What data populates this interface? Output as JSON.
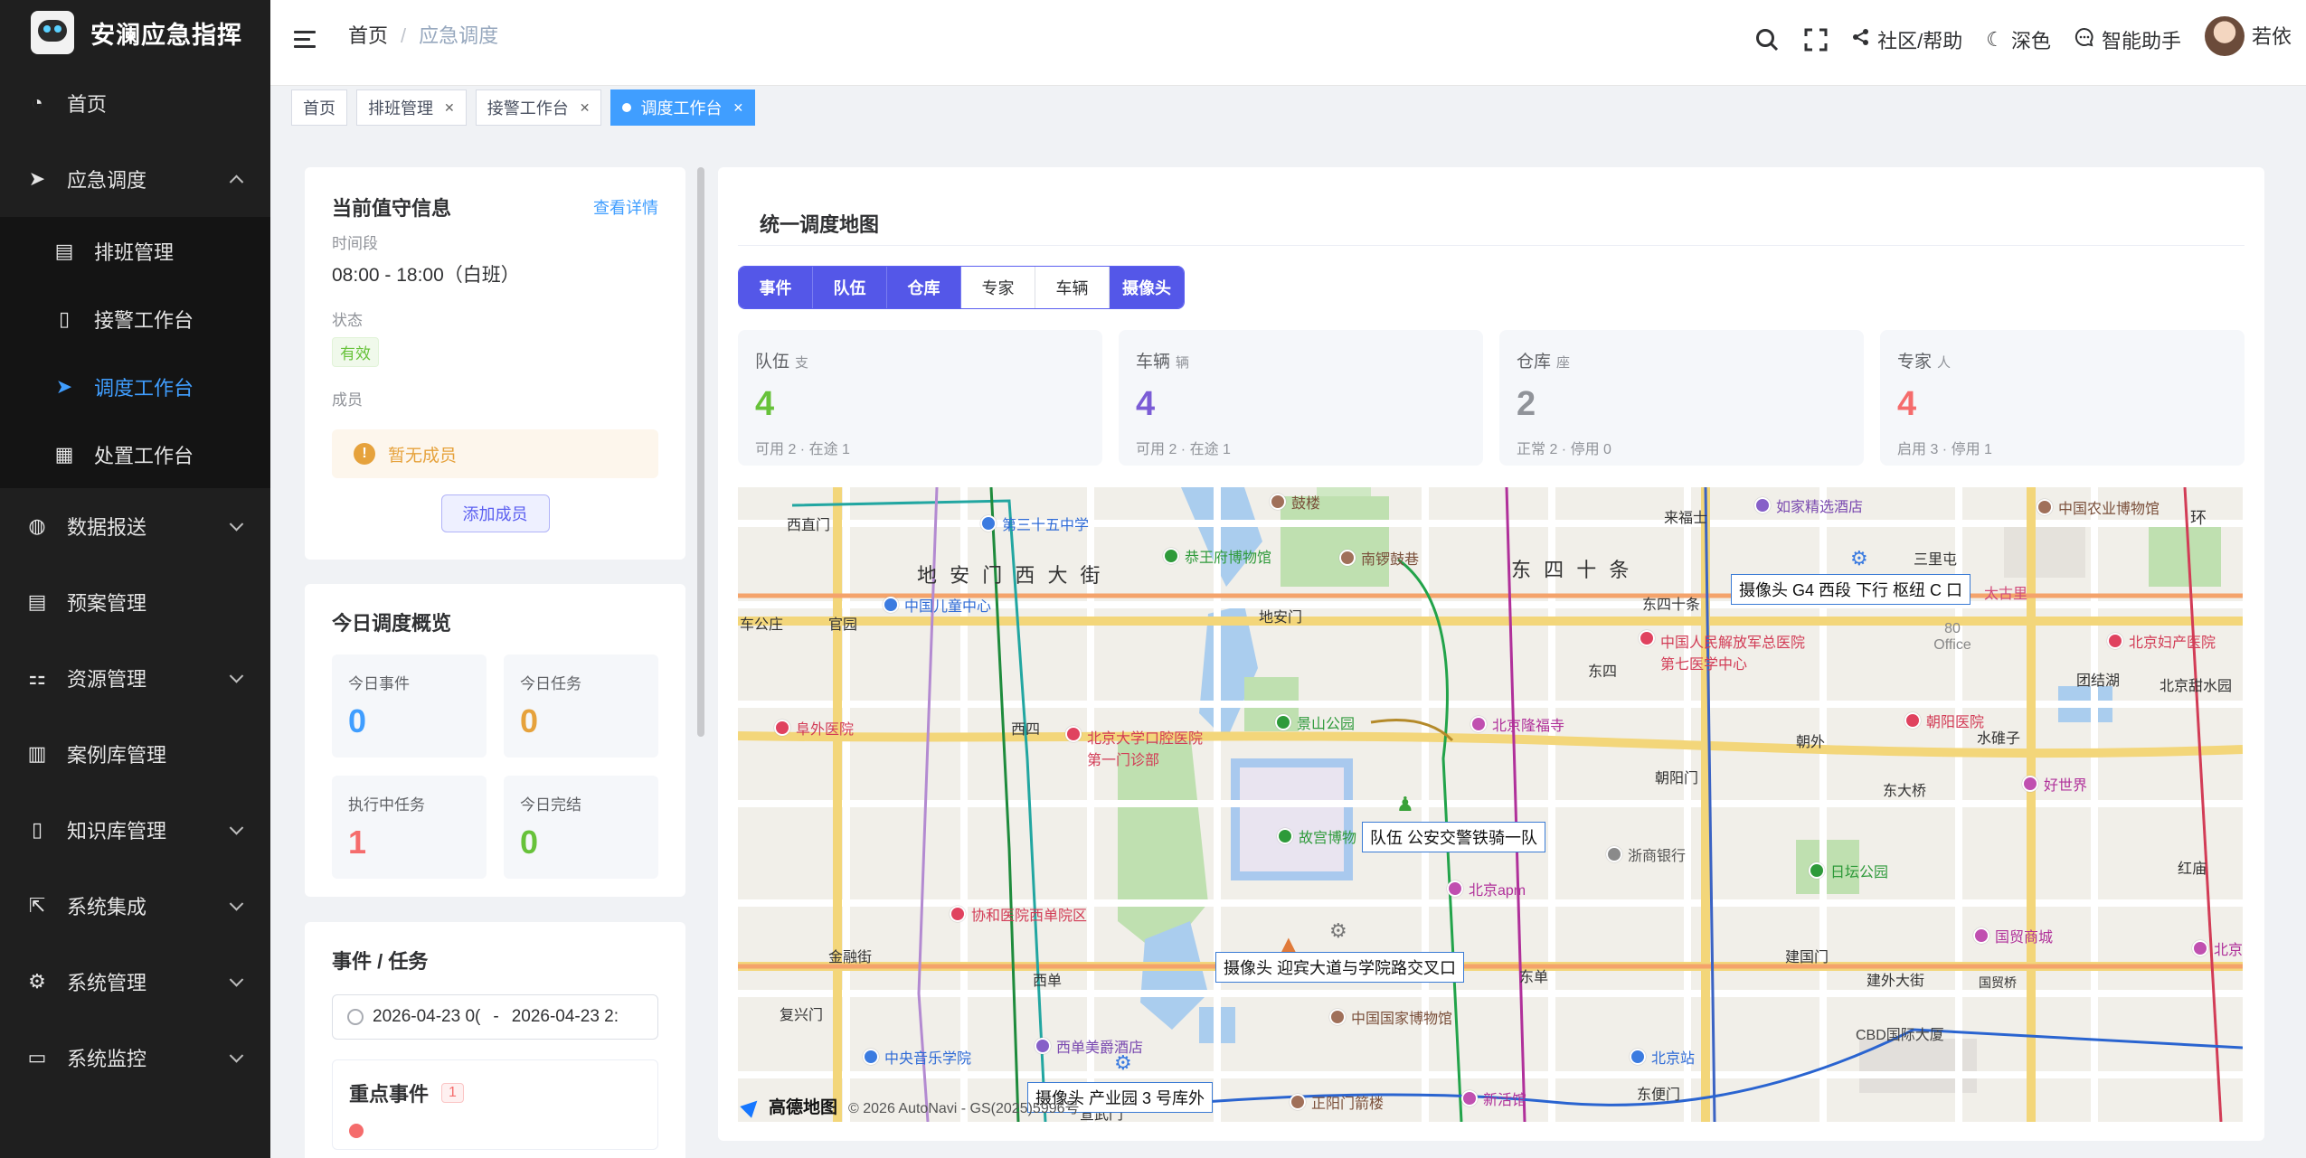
{
  "app": {
    "name": "安澜应急指挥"
  },
  "sidebar": {
    "items": [
      {
        "label": "首页"
      },
      {
        "label": "应急调度",
        "expanded": true
      },
      {
        "label": "数据报送"
      },
      {
        "label": "预案管理"
      },
      {
        "label": "资源管理"
      },
      {
        "label": "案例库管理"
      },
      {
        "label": "知识库管理"
      },
      {
        "label": "系统集成"
      },
      {
        "label": "系统管理"
      },
      {
        "label": "系统监控"
      }
    ],
    "subitems": [
      {
        "label": "排班管理"
      },
      {
        "label": "接警工作台"
      },
      {
        "label": "调度工作台",
        "active": true
      },
      {
        "label": "处置工作台"
      }
    ],
    "active_color": "#409eff"
  },
  "header": {
    "breadcrumb": [
      "首页",
      "应急调度"
    ],
    "actions": {
      "community": "社区/帮助",
      "theme": "深色",
      "assistant": "智能助手",
      "user": "若依"
    }
  },
  "tags": [
    {
      "label": "首页",
      "closable": false
    },
    {
      "label": "排班管理",
      "closable": true
    },
    {
      "label": "接警工作台",
      "closable": true
    },
    {
      "label": "调度工作台",
      "closable": true,
      "active": true
    }
  ],
  "duty": {
    "title": "当前值守信息",
    "detail_link": "查看详情",
    "period_label": "时间段",
    "period_value": "08:00 - 18:00（白班）",
    "status_label": "状态",
    "status_value": "有效",
    "members_label": "成员",
    "empty_members": "暂无成员",
    "add_member": "添加成员"
  },
  "overview": {
    "title": "今日调度概览",
    "stats": [
      {
        "label": "今日事件",
        "value": "0",
        "color": "#409eff"
      },
      {
        "label": "今日任务",
        "value": "0",
        "color": "#e6a23c"
      },
      {
        "label": "执行中任务",
        "value": "1",
        "color": "#f56c6c"
      },
      {
        "label": "今日完结",
        "value": "0",
        "color": "#67c23a"
      }
    ]
  },
  "events": {
    "title": "事件 / 任务",
    "date_start": "2026-04-23 0(",
    "date_sep": "-",
    "date_end": "2026-04-23 2:",
    "key_title": "重点事件",
    "key_count": "1"
  },
  "map_panel": {
    "title": "统一调度地图",
    "filters": [
      {
        "label": "事件",
        "on": true
      },
      {
        "label": "队伍",
        "on": true
      },
      {
        "label": "仓库",
        "on": true
      },
      {
        "label": "专家",
        "on": false
      },
      {
        "label": "车辆",
        "on": false
      },
      {
        "label": "摄像头",
        "on": true
      }
    ],
    "kpis": [
      {
        "title": "队伍",
        "unit": "支",
        "value": "4",
        "detail": "可用 2 · 在途 1",
        "color": "#67c23a"
      },
      {
        "title": "车辆",
        "unit": "辆",
        "value": "4",
        "detail": "可用 2 · 在途 1",
        "color": "#7b5cd6"
      },
      {
        "title": "仓库",
        "unit": "座",
        "value": "2",
        "detail": "正常 2 · 停用 0",
        "color": "#909399"
      },
      {
        "title": "专家",
        "unit": "人",
        "value": "4",
        "detail": "启用 3 · 停用 1",
        "color": "#f56c6c"
      }
    ]
  },
  "map": {
    "overlays": {
      "camera1": "摄像头 G4 西段 下行 枢纽 C 口",
      "team1": "队伍 公安交警铁骑一队",
      "camera2": "摄像头 迎宾大道与学院路交叉口",
      "camera3": "摄像头 产业园 3 号库外"
    },
    "roads": {
      "r1": "地 安 门 西 大 街",
      "r2": "东 四 十 条"
    },
    "places": {
      "p1": "西直门",
      "p2": "第三十五中学",
      "p3": "鼓楼",
      "p4": "恭王府博物馆",
      "p5": "南锣鼓巷",
      "p6": "来福士",
      "p7": "如家精选酒店",
      "p8": "中国农业博物馆",
      "p9": "三里屯",
      "p10": "车公庄",
      "p11": "官园",
      "p12": "中国儿童中心",
      "p13": "地安门",
      "p14": "东四十条",
      "p15": "太古里",
      "p16": "80 Office",
      "p17": "中国人民解放军总医院第七医学中心",
      "p18": "北京妇产医院",
      "p19": "东四",
      "p20": "团结湖",
      "p21": "北京甜水园",
      "p22": "阜外医院",
      "p23": "西四",
      "p24": "北京大学口腔医院第一门诊部",
      "p25": "景山公园",
      "p26": "北京隆福寺",
      "p27": "朝阳医院",
      "p28": "水碓子",
      "p29": "朝外",
      "p30": "朝阳门",
      "p31": "东大桥",
      "p32": "好世界",
      "p33": "故宫博物",
      "p34": "浙商银行",
      "p35": "日坛公园",
      "p36": "红庙",
      "p37": "北京apm",
      "p38": "协和医院西单院区",
      "p39": "金融街",
      "p40": "建国门",
      "p41": "国贸商城",
      "p42": "北京",
      "p43": "西单",
      "p44": "东单",
      "p45": "复兴门",
      "p46": "中国国家博物馆",
      "p47": "建外大街",
      "p48": "国贸桥",
      "p49": "CBD国际大厦",
      "p50": "中央音乐学院",
      "p51": "西单美爵酒店",
      "p52": "北京站",
      "p53": "正阳门箭楼",
      "p54": "新活馆",
      "p55": "东便门",
      "p56": "宣武门",
      "p57": "环"
    },
    "brand": "高德地图",
    "copyright": "© 2026 AutoNavi - GS(2025)5996号"
  }
}
